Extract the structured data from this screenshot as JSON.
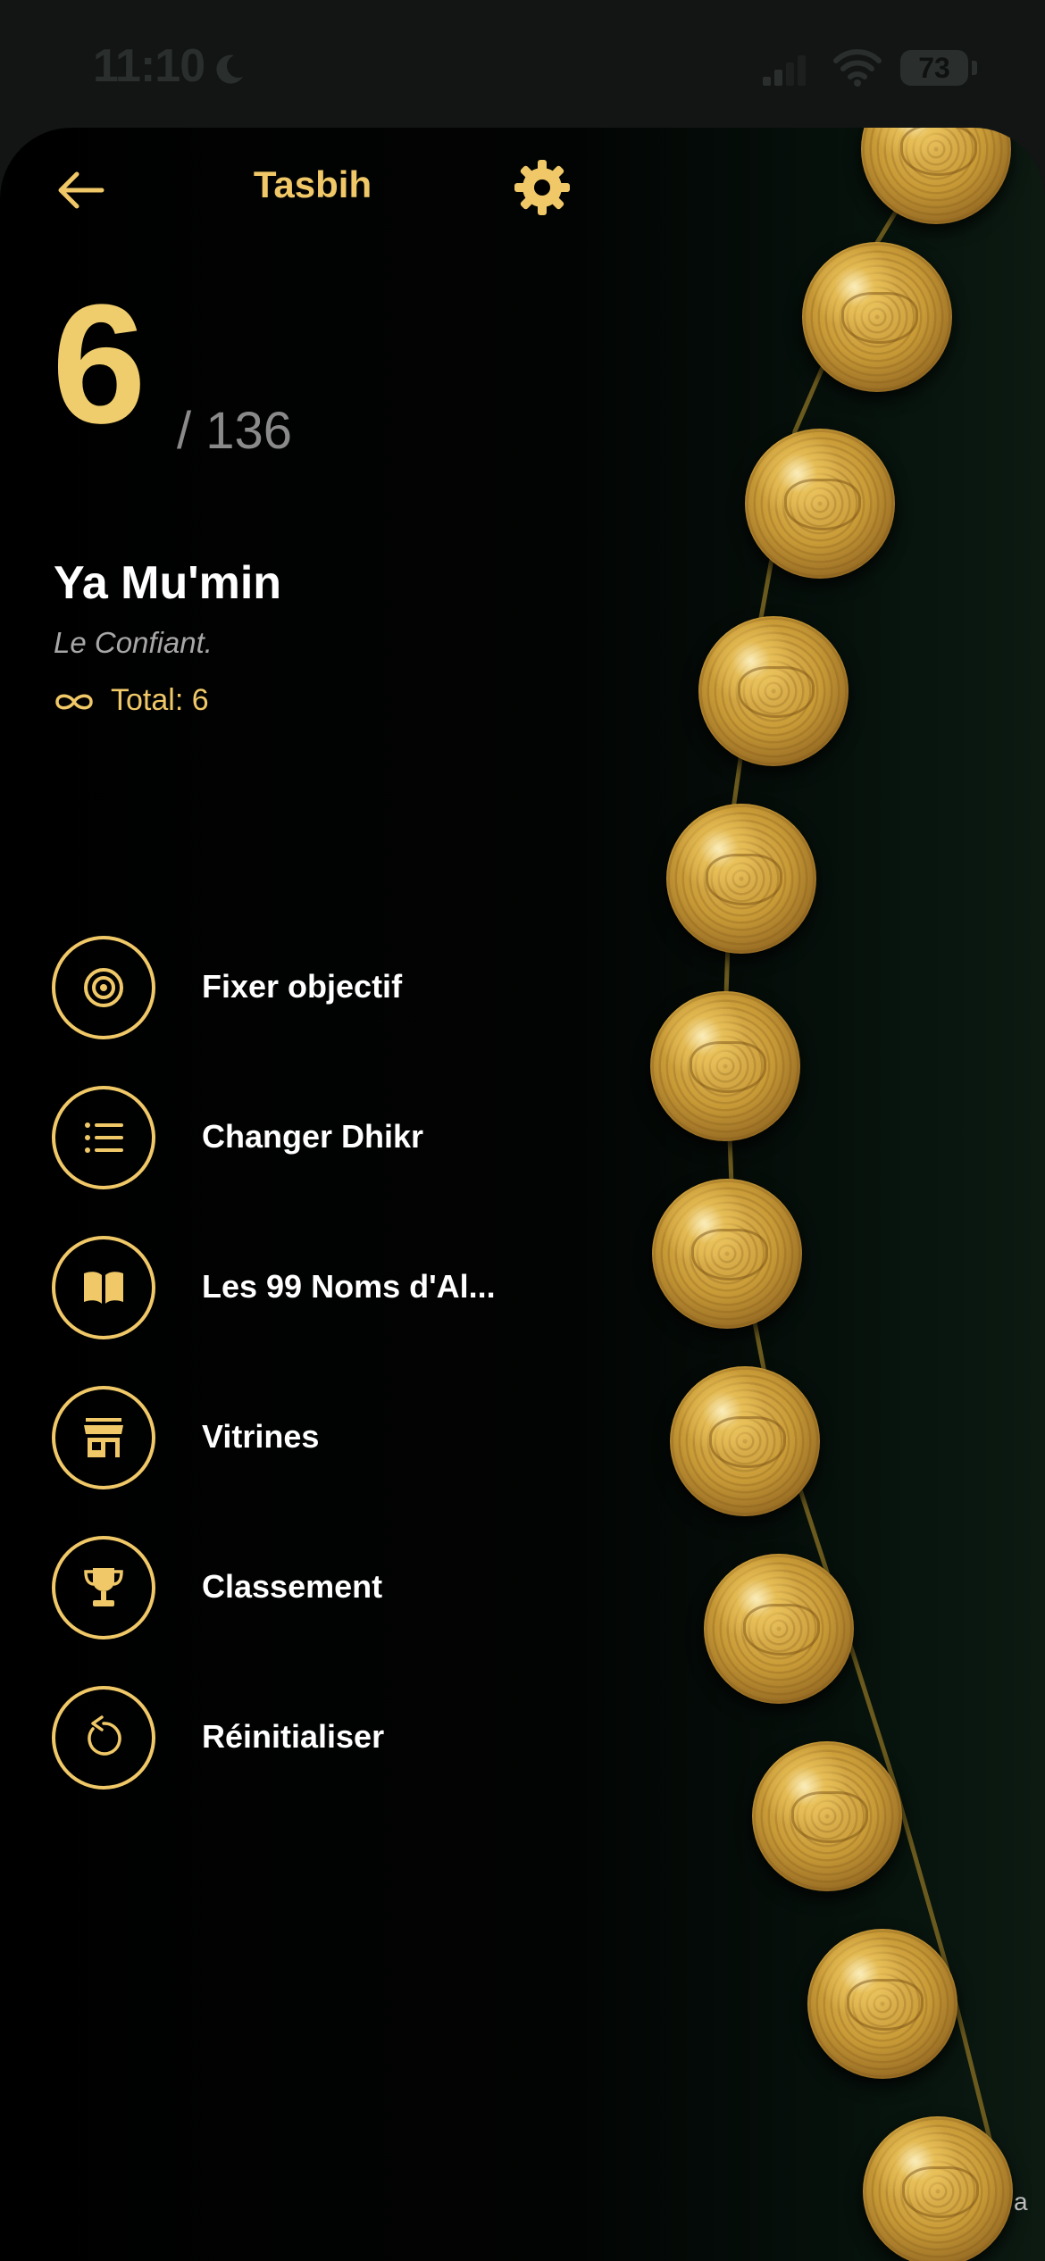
{
  "status_bar": {
    "time": "11:10",
    "battery": "73"
  },
  "header": {
    "title": "Tasbih"
  },
  "counter": {
    "count": "6",
    "goal": "/ 136"
  },
  "dhikr": {
    "name": "Ya Mu'min",
    "meaning": "Le Confiant.",
    "total": "Total: 6"
  },
  "menu": {
    "items": [
      {
        "label": "Fixer objectif",
        "icon": "target-icon"
      },
      {
        "label": "Changer Dhikr",
        "icon": "list-icon"
      },
      {
        "label": "Les 99 Noms d'Al...",
        "icon": "book-icon"
      },
      {
        "label": "Vitrines",
        "icon": "store-icon"
      },
      {
        "label": "Classement",
        "icon": "trophy-icon"
      },
      {
        "label": "Réinitialiser",
        "icon": "reset-icon"
      }
    ]
  },
  "footer": {
    "corner_text": "a"
  },
  "colors": {
    "accent": "#f0c868",
    "background": "#000000",
    "bead_gold": "#c99b37"
  }
}
